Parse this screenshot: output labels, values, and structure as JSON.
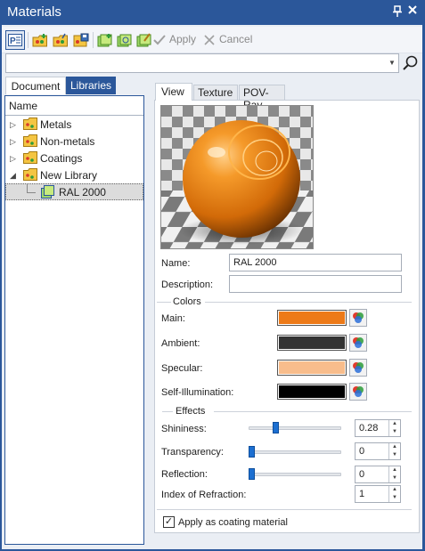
{
  "window": {
    "title": "Materials"
  },
  "toolbar": {
    "apply_label": "Apply",
    "cancel_label": "Cancel"
  },
  "search": {
    "value": ""
  },
  "left_tabs": {
    "document": "Document",
    "libraries": "Libraries"
  },
  "tree": {
    "header": "Name",
    "items": [
      {
        "label": "Metals"
      },
      {
        "label": "Non-metals"
      },
      {
        "label": "Coatings"
      },
      {
        "label": "New Library"
      },
      {
        "label": "RAL 2000"
      }
    ]
  },
  "right_tabs": {
    "view": "View",
    "texture": "Texture",
    "povray": "POV-Ray"
  },
  "form": {
    "name_label": "Name:",
    "name_value": "RAL 2000",
    "description_label": "Description:",
    "description_value": "",
    "colors_group": "Colors",
    "main_label": "Main:",
    "ambient_label": "Ambient:",
    "specular_label": "Specular:",
    "self_illum_label": "Self-Illumination:",
    "effects_group": "Effects",
    "shininess_label": "Shininess:",
    "shininess_value": "0.28",
    "transparency_label": "Transparency:",
    "transparency_value": "0",
    "reflection_label": "Reflection:",
    "reflection_value": "0",
    "ior_label": "Index of Refraction:",
    "ior_value": "1",
    "coating_label": "Apply as coating material",
    "coating_checked": true
  },
  "colors": {
    "main": "#ed7a18",
    "ambient": "#333333",
    "specular": "#f8bd8c",
    "self_illumination": "#000000",
    "accent": "#2b579a"
  },
  "slider_levels": {
    "shininess": 0.28,
    "transparency": 0,
    "reflection": 0
  }
}
